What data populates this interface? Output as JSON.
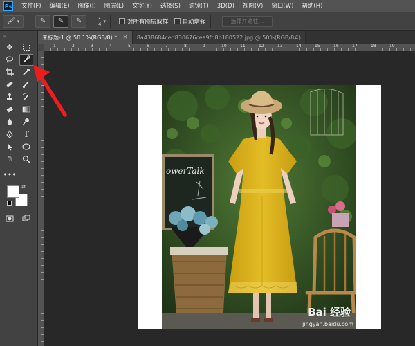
{
  "menu": {
    "logo": "Ps",
    "items": [
      "文件(F)",
      "编辑(E)",
      "图像(I)",
      "图层(L)",
      "文字(Y)",
      "选择(S)",
      "滤镜(T)",
      "3D(D)",
      "视图(V)",
      "窗口(W)",
      "帮助(H)"
    ]
  },
  "options": {
    "brush_size": "4",
    "sample_all_layers": "对所有图层取样",
    "auto_enhance": "自动增强",
    "select_subject": "选择并遮住..."
  },
  "tabs": [
    {
      "label": "未标题-1 @ 50.1%(RGB/8) *",
      "close": "×"
    },
    {
      "label": "8a438684ced830676cea9fd8b180522.jpg @ 50%(RGB/8#)",
      "close": ""
    }
  ],
  "rulers": {
    "top_numbers": [
      "1",
      "2",
      "3",
      "4",
      "5",
      "6",
      "7",
      "8",
      "9",
      "10",
      "11",
      "12",
      "13",
      "14",
      "15",
      "16",
      "17",
      "18",
      "19"
    ]
  },
  "photo": {
    "chalkboard_text": "owerTalk",
    "watermark": "Bai 经验",
    "watermark_url": "jingyan.baidu.com"
  },
  "colors": {
    "foreground": "#ffffff",
    "background": "#ffffff",
    "arrow": "#ee1c1c",
    "dress": "#d9b21a"
  }
}
